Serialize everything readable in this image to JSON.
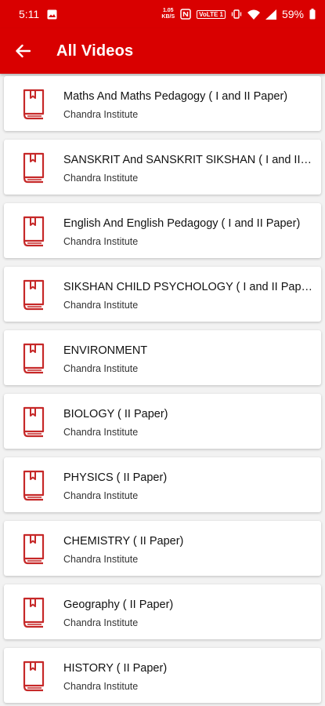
{
  "status_bar": {
    "time": "5:11",
    "net_speed_value": "1.05",
    "net_speed_unit": "KB/S",
    "volte": "VoLTE 1",
    "battery": "59%"
  },
  "app_bar": {
    "title": "All Videos",
    "back_icon": "arrow-left-icon"
  },
  "colors": {
    "accent": "#d90000",
    "icon": "#c62828"
  },
  "courses": [
    {
      "title": "Maths And Maths Pedagogy ( I and II Paper)",
      "subtitle": "Chandra Institute"
    },
    {
      "title": "SANSKRIT And SANSKRIT SIKSHAN ( I and II Paper)",
      "subtitle": "Chandra Institute"
    },
    {
      "title": "English And English Pedagogy ( I and II Paper)",
      "subtitle": "Chandra Institute"
    },
    {
      "title": "SIKSHAN CHILD PSYCHOLOGY ( I and II Paper)",
      "subtitle": "Chandra Institute"
    },
    {
      "title": "ENVIRONMENT",
      "subtitle": "Chandra Institute"
    },
    {
      "title": "BIOLOGY ( II Paper)",
      "subtitle": "Chandra Institute"
    },
    {
      "title": "PHYSICS ( II Paper)",
      "subtitle": "Chandra Institute"
    },
    {
      "title": "CHEMISTRY ( II Paper)",
      "subtitle": "Chandra Institute"
    },
    {
      "title": "Geography ( II Paper)",
      "subtitle": "Chandra Institute"
    },
    {
      "title": "HISTORY ( II Paper)",
      "subtitle": "Chandra Institute"
    }
  ]
}
